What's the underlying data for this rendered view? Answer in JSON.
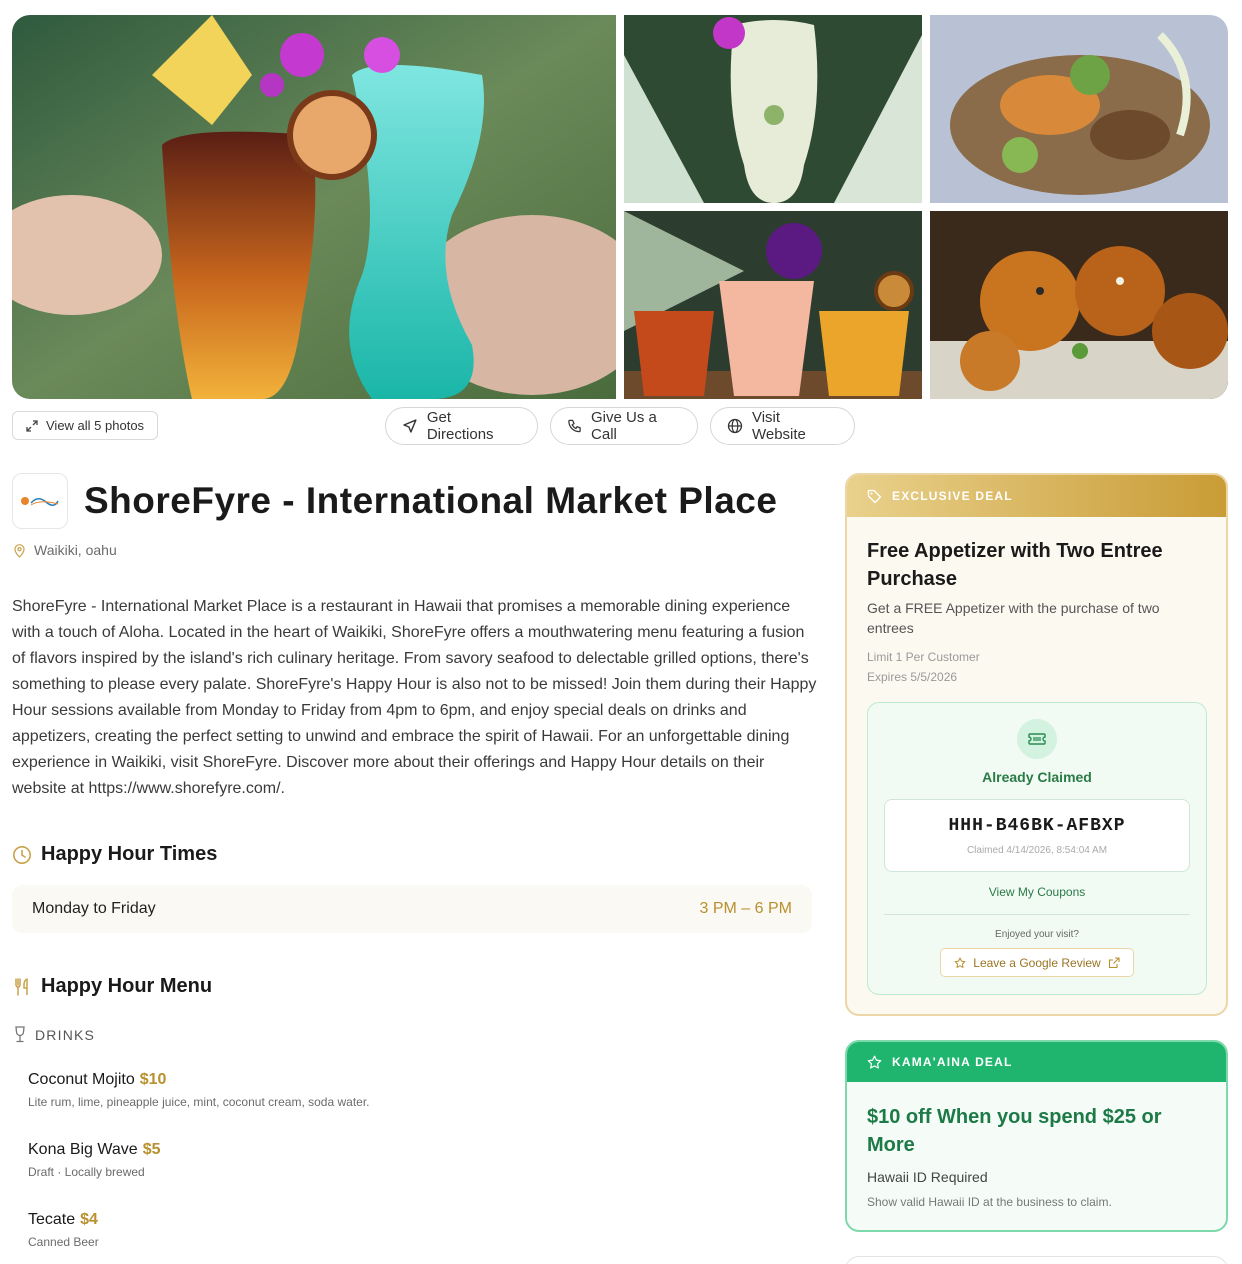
{
  "gallery": {
    "view_all_label": "View all 5 photos"
  },
  "actions": {
    "directions_label": "Get Directions",
    "call_label": "Give Us a Call",
    "website_label": "Visit Website"
  },
  "business": {
    "name": "ShoreFyre - International Market Place",
    "location": "Waikiki, oahu",
    "description": "ShoreFyre - International Market Place is a restaurant in Hawaii that promises a memorable dining experience with a touch of Aloha. Located in the heart of Waikiki, ShoreFyre offers a mouthwatering menu featuring a fusion of flavors inspired by the island's rich culinary heritage. From savory seafood to delectable grilled options, there's something to please every palate. ShoreFyre's Happy Hour is also not to be missed! Join them during their Happy Hour sessions available from Monday to Friday from 4pm to 6pm, and enjoy special deals on drinks and appetizers, creating the perfect setting to unwind and embrace the spirit of Hawaii. For an unforgettable dining experience in Waikiki, visit ShoreFyre. Discover more about their offerings and Happy Hour details on their website at https://www.shorefyre.com/."
  },
  "happy_hour_times": {
    "heading": "Happy Hour Times",
    "rows": [
      {
        "days": "Monday to Friday",
        "time": "3 PM – 6 PM"
      }
    ]
  },
  "happy_hour_menu": {
    "heading": "Happy Hour Menu",
    "drinks_heading": "DRINKS",
    "items": [
      {
        "name": "Coconut Mojito",
        "price": "$10",
        "detail": "Lite rum, lime, pineapple juice, mint, coconut cream, soda water."
      },
      {
        "name": "Kona Big Wave",
        "price": "$5",
        "detail": "Draft · Locally brewed"
      },
      {
        "name": "Tecate",
        "price": "$4",
        "detail": "Canned Beer"
      }
    ]
  },
  "exclusive_deal": {
    "badge": "EXCLUSIVE DEAL",
    "title": "Free Appetizer with Two Entree Purchase",
    "subtitle": "Get a FREE Appetizer with the purchase of two entrees",
    "limit": "Limit 1 Per Customer",
    "expires": "Expires 5/5/2026",
    "status": "Already Claimed",
    "code": "HHH-B46BK-AFBXP",
    "claimed_at": "Claimed 4/14/2026, 8:54:04 AM",
    "view_coupons": "View My Coupons",
    "enjoyed_prompt": "Enjoyed your visit?",
    "review_label": "Leave a Google Review"
  },
  "kamaaina_deal": {
    "badge": "KAMA'AINA DEAL",
    "title": "$10 off When you spend $25 or More",
    "requirement": "Hawaii ID Required",
    "note": "Show valid Hawaii ID at the business to claim."
  },
  "colors": {
    "accent_gold": "#b8902e",
    "deal_green": "#20b56f",
    "text_dark": "#1a1a1a"
  }
}
